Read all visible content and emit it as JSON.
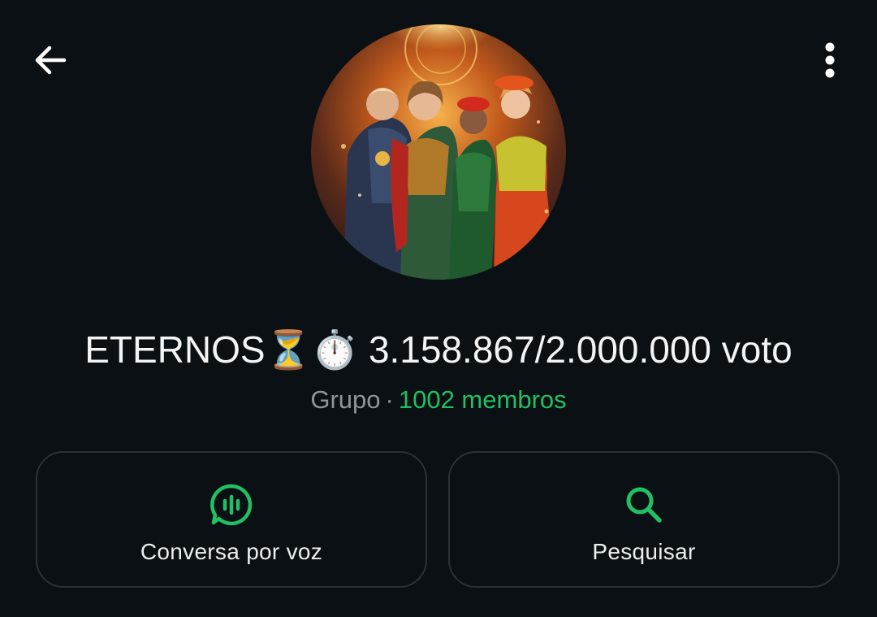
{
  "header": {
    "back_icon": "arrow-left-icon",
    "menu_icon": "more-vertical-icon"
  },
  "group": {
    "title": "ETERNOS⏳⏱️ 3.158.867/2.000.000 voto",
    "type_label": "Grupo",
    "separator": "·",
    "members_label": "1002 membros",
    "avatar_alt": "group-avatar"
  },
  "actions": {
    "voice_chat": {
      "label": "Conversa por voz",
      "icon": "voice-chat-icon"
    },
    "search": {
      "label": "Pesquisar",
      "icon": "search-icon"
    }
  },
  "colors": {
    "background": "#0b1014",
    "accent_green": "#21c063",
    "muted_text": "#8d9598",
    "card_border": "#2b3236"
  }
}
